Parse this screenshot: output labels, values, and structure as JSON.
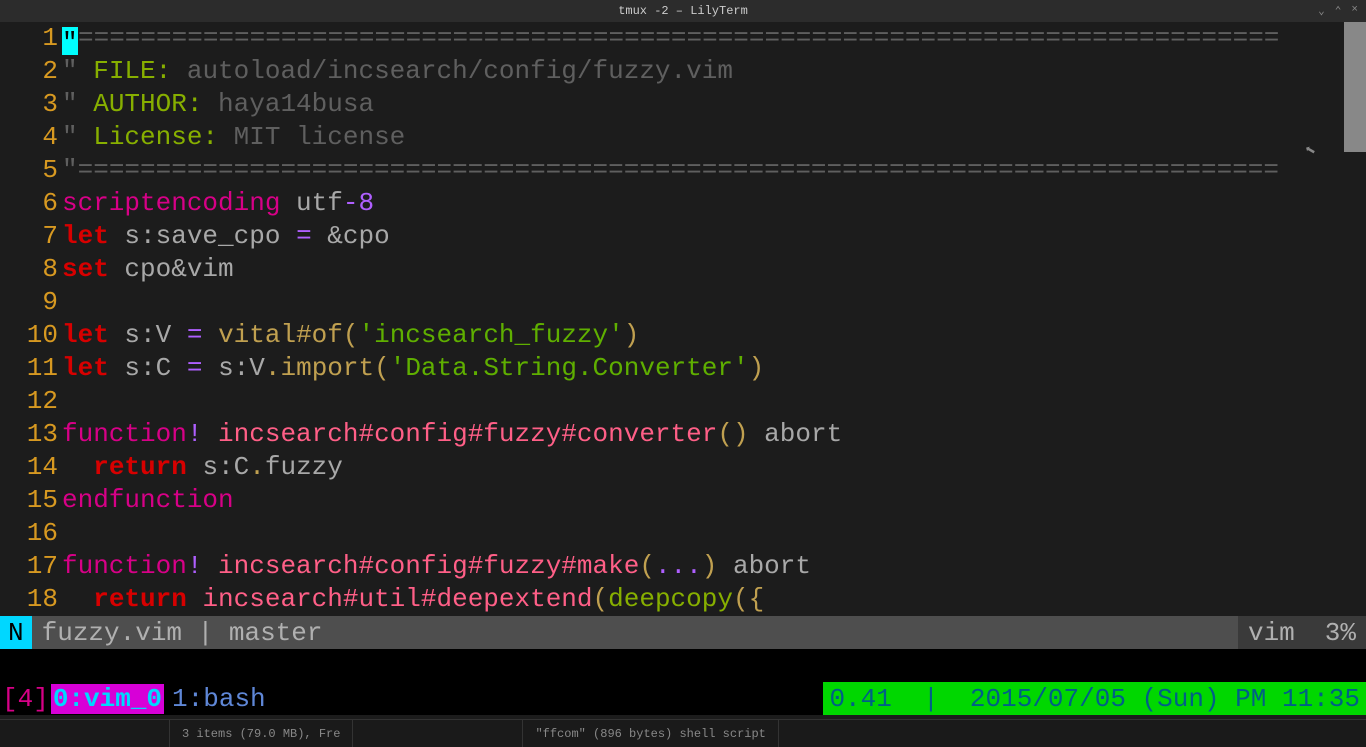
{
  "window": {
    "title": "tmux -2 – LilyTerm"
  },
  "gutter_lines": [
    "1",
    "2",
    "3",
    "4",
    "5",
    "6",
    "7",
    "8",
    "9",
    "10",
    "11",
    "12",
    "13",
    "14",
    "15",
    "16",
    "17",
    "18"
  ],
  "code": {
    "rule": "=============================================================================",
    "file_label": "FILE:",
    "file_value": "autoload/incsearch/config/fuzzy.vim",
    "author_label": "AUTHOR:",
    "author_value": "haya14busa",
    "license_label": "License:",
    "license_value": "MIT license",
    "l6_kw": "scriptencoding",
    "l6_val": "utf",
    "l6_dash": "-",
    "l6_num": "8",
    "l7_let": "let",
    "l7_var": "s:save_cpo",
    "l7_eq": "=",
    "l7_rhs": "&cpo",
    "l8_set": "set",
    "l8_opt": "cpo&vim",
    "l10_let": "let",
    "l10_var": "s:V",
    "l10_eq": "=",
    "l10_fn": "vital#of",
    "l10_lp": "(",
    "l10_str": "'incsearch_fuzzy'",
    "l10_rp": ")",
    "l11_let": "let",
    "l11_var": "s:C",
    "l11_eq": "=",
    "l11_obj": "s:V",
    "l11_dot": ".",
    "l11_m": "import",
    "l11_lp": "(",
    "l11_str": "'Data.String.Converter'",
    "l11_rp": ")",
    "l13_fn": "function",
    "l13_bang": "!",
    "l13_name": "incsearch#config#fuzzy#converter",
    "l13_lp": "(",
    "l13_rp": ")",
    "l13_abort": "abort",
    "l14_ret": "return",
    "l14_obj": "s:C",
    "l14_dot": ".",
    "l14_m": "fuzzy",
    "l15_endf": "endfunction",
    "l17_fn": "function",
    "l17_bang": "!",
    "l17_name": "incsearch#config#fuzzy#make",
    "l17_lp": "(",
    "l17_args": "...",
    "l17_rp": ")",
    "l17_abort": "abort",
    "l18_ret": "return",
    "l18_name": "incsearch#util#deepextend",
    "l18_lp": "(",
    "l18_call": "deepcopy",
    "l18_lp2": "(",
    "l18_br": "{"
  },
  "status": {
    "mode": "N",
    "file": "fuzzy.vim",
    "sep": "|",
    "branch": "master",
    "filetype": "vim",
    "percent": "3%"
  },
  "tmux": {
    "session": "[4]",
    "win0": "0:vim_0",
    "win1": "1:bash",
    "load": "0.41",
    "sep": "|",
    "datetime": "2015/07/05 (Sun) PM 11:35"
  },
  "taskbar": {
    "item1": "3 items (79.0 MB), Fre",
    "item2": "\"ffcom\" (896 bytes) shell script"
  }
}
